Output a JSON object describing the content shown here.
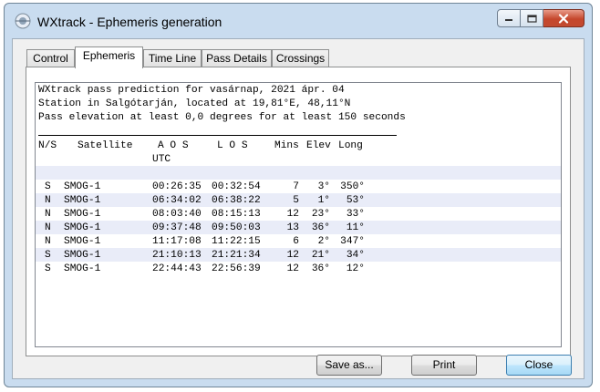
{
  "window": {
    "title": "WXtrack - Ephemeris generation"
  },
  "tabs": [
    "Control",
    "Ephemeris",
    "Time Line",
    "Pass Details",
    "Crossings"
  ],
  "report": {
    "lines": [
      "WXtrack pass prediction for vasárnap, 2021 ápr. 04",
      "Station in Salgótarján, located at 19,81°E, 48,11°N",
      "Pass elevation at least 0,0 degrees for at least 150 seconds"
    ],
    "columns": {
      "ns": "N/S",
      "satellite": "Satellite",
      "aos": "A O S",
      "los": "L O S",
      "mins": "Mins",
      "elev": "Elev",
      "long": "Long",
      "utc": "UTC"
    },
    "rows": [
      {
        "ns": "S",
        "satellite": "SMOG-1",
        "aos": "00:26:35",
        "los": "00:32:54",
        "mins": "7",
        "elev": "3°",
        "long": "350°"
      },
      {
        "ns": "N",
        "satellite": "SMOG-1",
        "aos": "06:34:02",
        "los": "06:38:22",
        "mins": "5",
        "elev": "1°",
        "long": "53°"
      },
      {
        "ns": "N",
        "satellite": "SMOG-1",
        "aos": "08:03:40",
        "los": "08:15:13",
        "mins": "12",
        "elev": "23°",
        "long": "33°"
      },
      {
        "ns": "N",
        "satellite": "SMOG-1",
        "aos": "09:37:48",
        "los": "09:50:03",
        "mins": "13",
        "elev": "36°",
        "long": "11°"
      },
      {
        "ns": "N",
        "satellite": "SMOG-1",
        "aos": "11:17:08",
        "los": "11:22:15",
        "mins": "6",
        "elev": "2°",
        "long": "347°"
      },
      {
        "ns": "S",
        "satellite": "SMOG-1",
        "aos": "21:10:13",
        "los": "21:21:34",
        "mins": "12",
        "elev": "21°",
        "long": "34°"
      },
      {
        "ns": "S",
        "satellite": "SMOG-1",
        "aos": "22:44:43",
        "los": "22:56:39",
        "mins": "12",
        "elev": "36°",
        "long": "12°"
      }
    ]
  },
  "buttons": {
    "save_as": "Save as...",
    "print": "Print",
    "close": "Close"
  },
  "colors": {
    "frame": "#c9dcef",
    "row_band": "#e9ecf8",
    "close_red": "#c5472c",
    "default_button": "#3c7fb1"
  }
}
